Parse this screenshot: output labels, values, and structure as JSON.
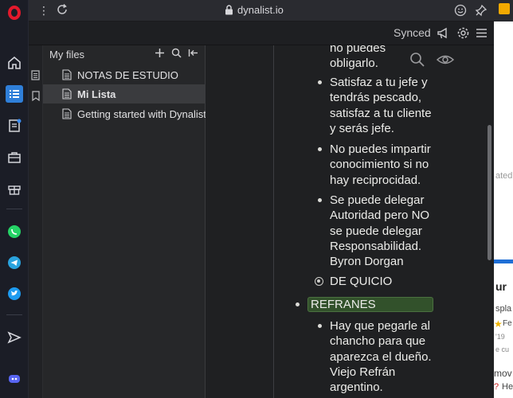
{
  "browser": {
    "url": "dynalist.io",
    "menu_glyph": "⋮"
  },
  "dynalist": {
    "sync_status": "Synced",
    "files_title": "My files",
    "files": [
      {
        "label": "NOTAS DE ESTUDIO",
        "active": false
      },
      {
        "label": "Mi Lista",
        "active": true
      },
      {
        "label": "Getting started with Dynalist",
        "active": false
      }
    ]
  },
  "document": {
    "items": [
      {
        "lines": [
          "no puedes",
          "obligarlo."
        ]
      },
      {
        "lines": [
          "Satisfaz a tu jefe y",
          "tendrás pescado,",
          "satisfaz a tu cliente",
          "y serás jefe."
        ]
      },
      {
        "lines": [
          "No puedes impartir",
          "conocimiento si no",
          "hay reciprocidad."
        ]
      },
      {
        "lines": [
          "Se puede delegar",
          "Autoridad pero NO",
          "se puede delegar",
          "Responsabilidad.",
          "Byron Dorgan"
        ]
      },
      {
        "lines": [
          "DE QUICIO"
        ]
      },
      {
        "lines": [
          "REFRANES"
        ]
      },
      {
        "lines": [
          "Hay que pegarle al",
          "chancho para que",
          "aparezca el dueño.",
          "Viejo Refrán",
          "argentino."
        ]
      }
    ]
  },
  "behind_window": {
    "texts": [
      "ated",
      "ur",
      "spla",
      "Fe",
      "'19",
      "e cu",
      "mov",
      "He"
    ]
  },
  "colors": {
    "opera_red": "#e4192c",
    "highlight_green": "#32512b",
    "whatsapp": "#25d366",
    "telegram": "#2aa3de",
    "twitter": "#1d9bf0",
    "discord": "#5865f2"
  }
}
